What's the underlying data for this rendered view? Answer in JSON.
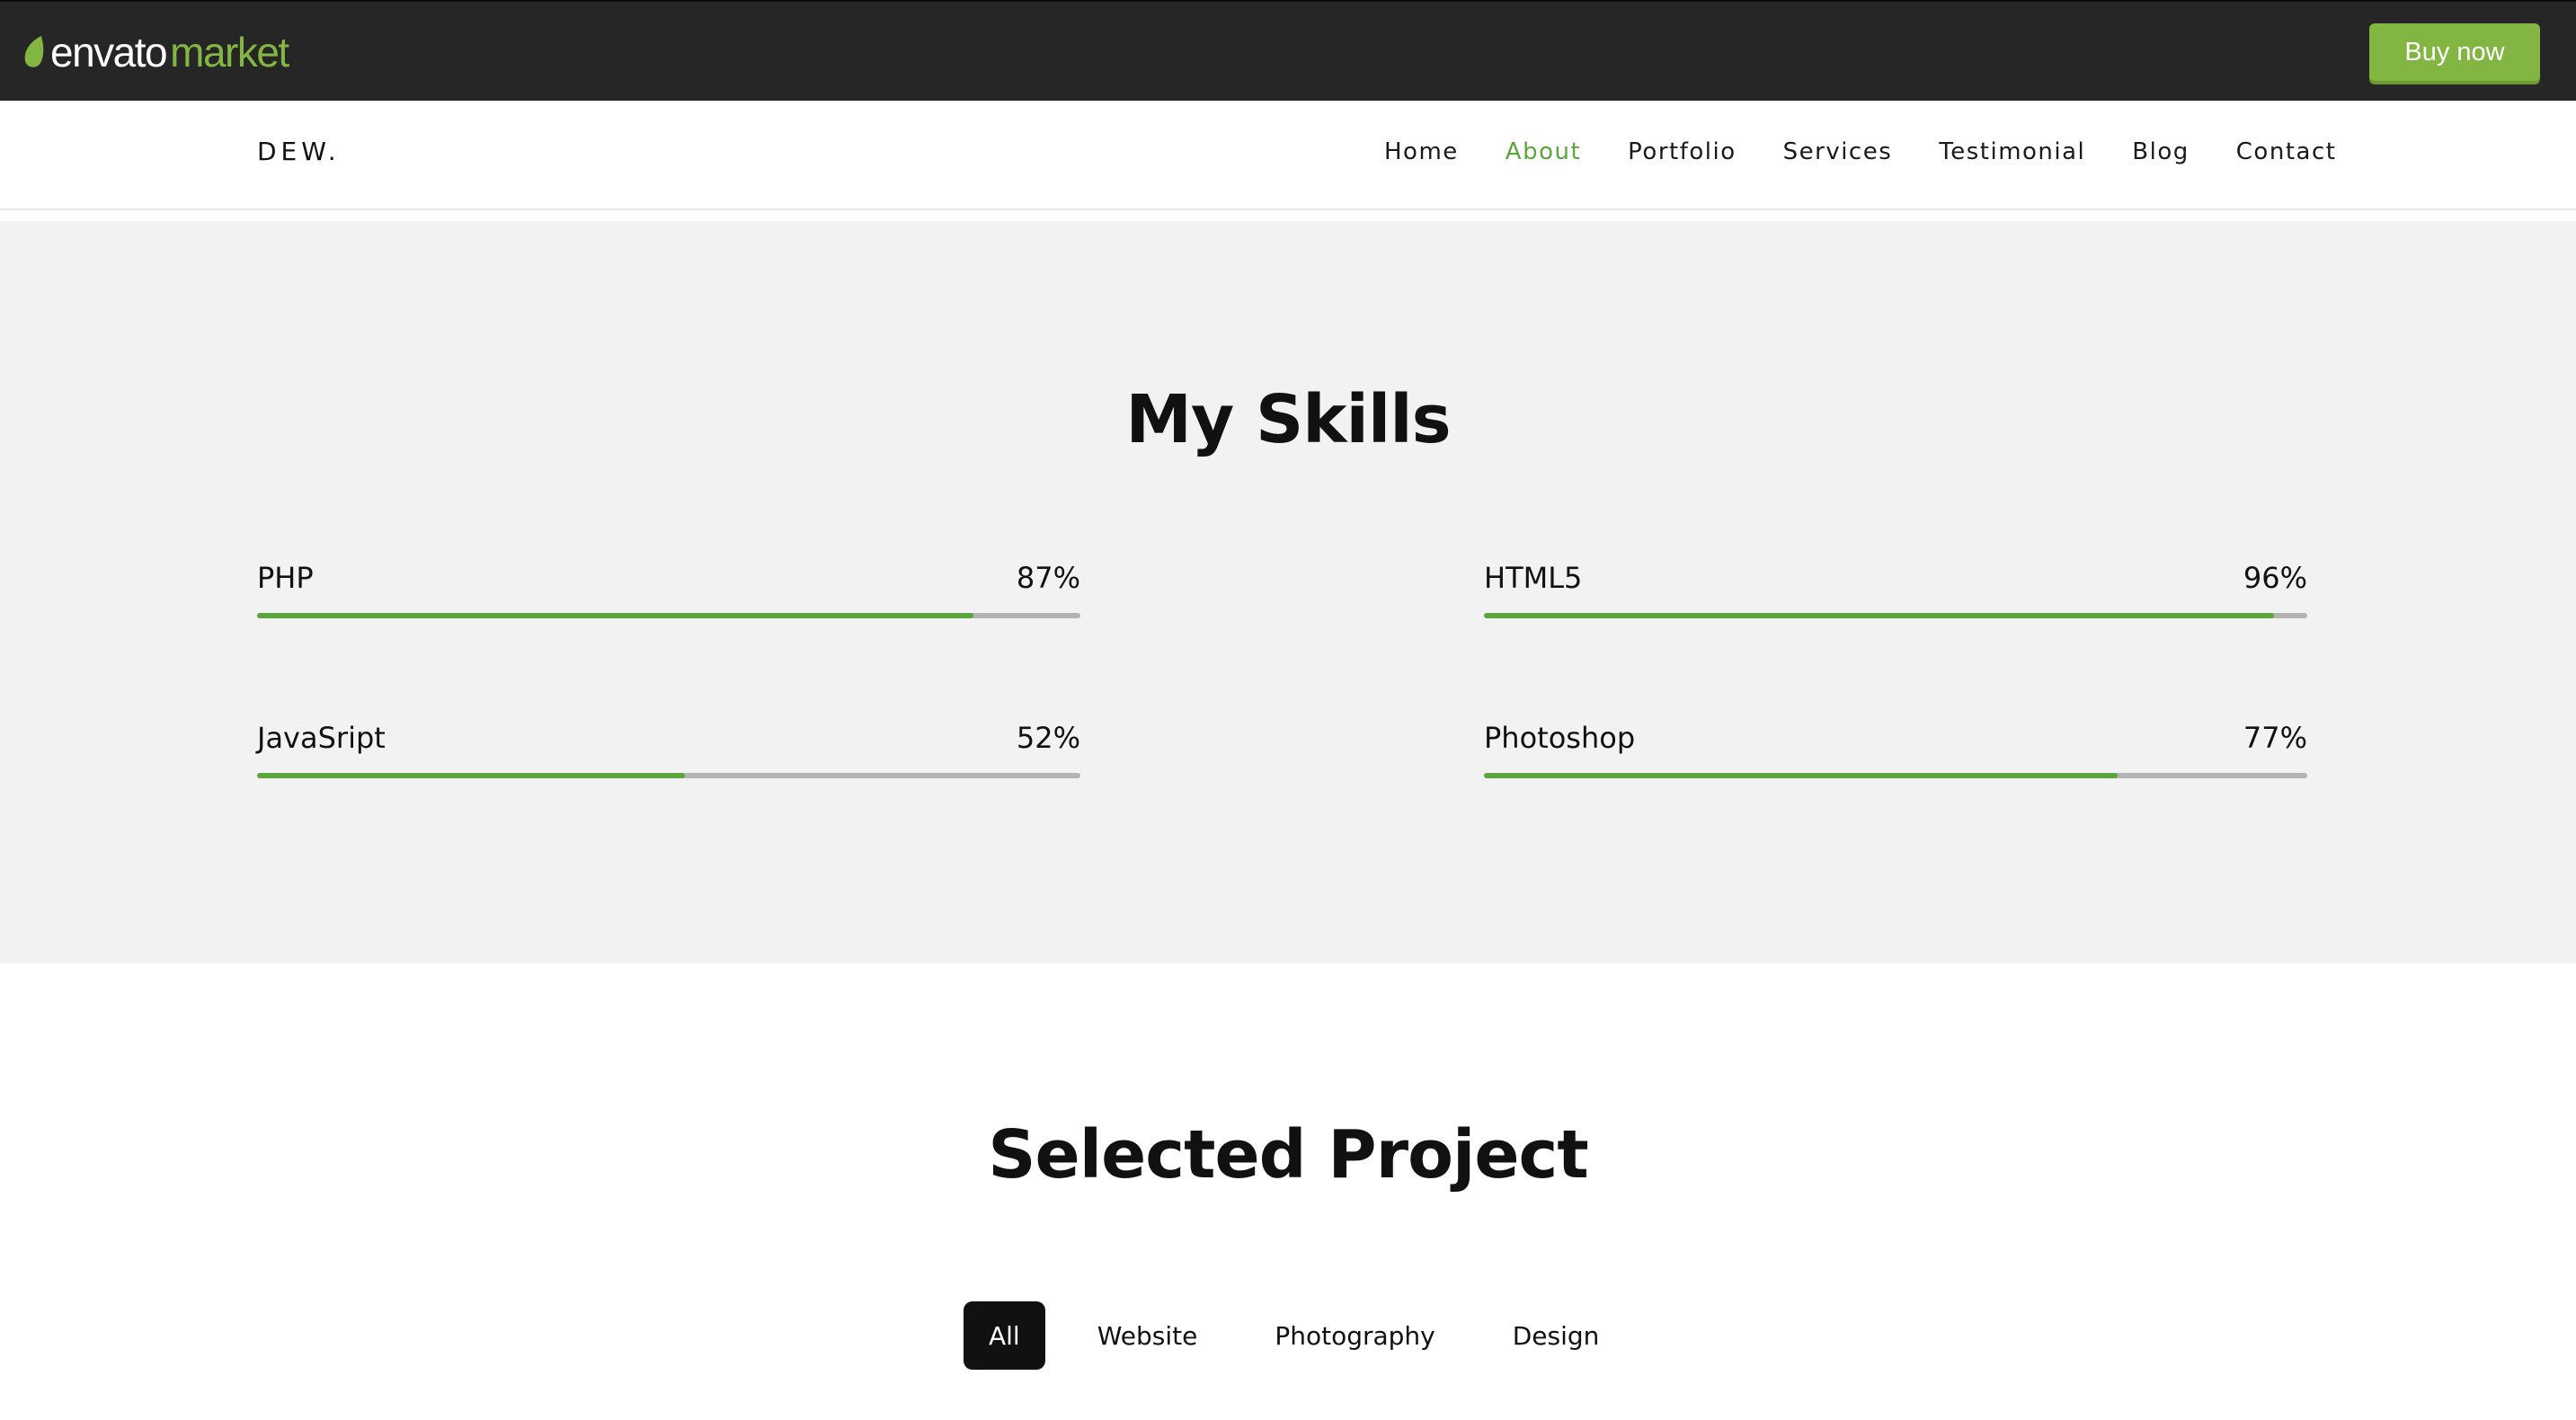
{
  "envato_bar": {
    "logo_primary": "envato",
    "logo_secondary": "market",
    "buy_now_label": "Buy now",
    "brand_color": "#82b541"
  },
  "header": {
    "brand": "DEW.",
    "nav": [
      {
        "label": "Home",
        "active": false
      },
      {
        "label": "About",
        "active": true
      },
      {
        "label": "Portfolio",
        "active": false
      },
      {
        "label": "Services",
        "active": false
      },
      {
        "label": "Testimonial",
        "active": false
      },
      {
        "label": "Blog",
        "active": false
      },
      {
        "label": "Contact",
        "active": false
      }
    ],
    "active_color": "#5aa63d"
  },
  "skills": {
    "title": "My Skills",
    "items": [
      {
        "name": "PHP",
        "percent_label": "87%",
        "value": 87
      },
      {
        "name": "HTML5",
        "percent_label": "96%",
        "value": 96
      },
      {
        "name": "JavaSript",
        "percent_label": "52%",
        "value": 52
      },
      {
        "name": "Photoshop",
        "percent_label": "77%",
        "value": 77
      }
    ],
    "bar_color": "#5aa63d",
    "track_color": "#b3b3b3"
  },
  "projects": {
    "title": "Selected Project",
    "filters": [
      {
        "label": "All",
        "active": true
      },
      {
        "label": "Website",
        "active": false
      },
      {
        "label": "Photography",
        "active": false
      },
      {
        "label": "Design",
        "active": false
      }
    ]
  }
}
